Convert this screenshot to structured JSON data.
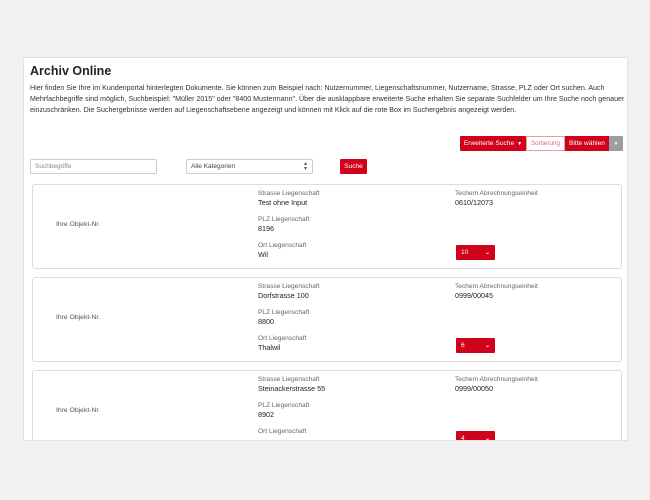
{
  "page": {
    "title": "Archiv Online",
    "intro": "Hier finden Sie Ihre im Kundenportal hinterlegten Dokumente. Sie können zum Beispiel nach: Nutzernummer, Liegenschaftsnummer, Nutzername, Strasse, PLZ oder Ort suchen. Auch Mehrfachbegriffe sind möglich, Suchbeispiel: \"Müller 2015\" oder \"8400 Mustermann\". Über die ausklappbare erweiterte Suche erhalten Sie separate Suchfelder um Ihre Suche noch genauer einzuschränken. Die Suchergebnisse werden auf Liegenschaftsebene angezeigt und können mit Klick auf die rote Box im Suchergebnis angezeigt werden."
  },
  "toolbar": {
    "advanced_search_label": "Erweiterte Suche",
    "sort_label": "Sortierung",
    "sort_value": "Bitte wählen"
  },
  "search": {
    "placeholder": "Suchbegriffe",
    "category_value": "Alle Kategorien",
    "submit_label": "Suche"
  },
  "results": [
    {
      "objnr_label": "Ihre Objekt-Nr.",
      "strasse_label": "Strasse Liegenschaft",
      "strasse": "Test ohne Input",
      "plz_label": "PLZ Liegenschaft",
      "plz": "8196",
      "ort_label": "Ort Liegenschaft",
      "ort": "Wil",
      "abrechnung_label": "Techem Abrechnungseinheit",
      "abrechnung": "0610/12073",
      "count": "10"
    },
    {
      "objnr_label": "Ihre Objekt-Nr.",
      "strasse_label": "Strasse Liegenschaft",
      "strasse": "Dorfstrasse 100",
      "plz_label": "PLZ Liegenschaft",
      "plz": "8800",
      "ort_label": "Ort Liegenschaft",
      "ort": "Thalwil",
      "abrechnung_label": "Techem Abrechnungseinheit",
      "abrechnung": "0999/00045",
      "count": "6"
    },
    {
      "objnr_label": "Ihre Objekt-Nr.",
      "strasse_label": "Strasse Liegenschaft",
      "strasse": "Steinackerstrasse 55",
      "plz_label": "PLZ Liegenschaft",
      "plz": "8902",
      "ort_label": "Ort Liegenschaft",
      "ort": "",
      "abrechnung_label": "Techem Abrechnungseinheit",
      "abrechnung": "0999/00050",
      "count": "4"
    }
  ],
  "colors": {
    "accent": "#d0021b",
    "gray_button": "#9e9e9e"
  },
  "icons": {
    "dropdown": "chevron-down-icon",
    "select": "sort-arrows-icon"
  }
}
